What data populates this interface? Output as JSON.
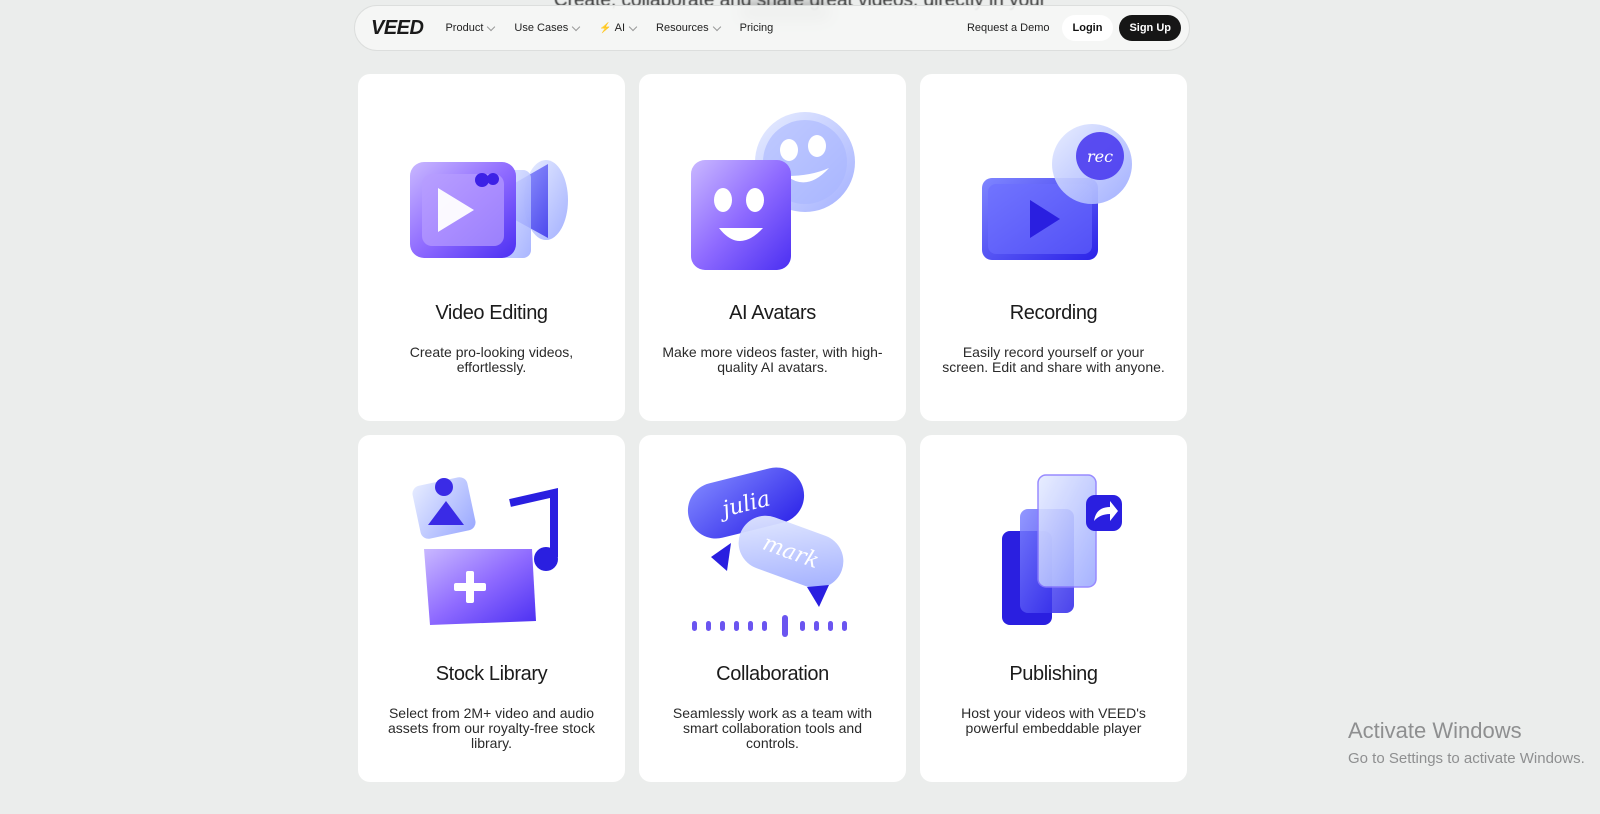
{
  "background_headline": "Create, collaborate and share great videos, directly in your",
  "nav": {
    "logo": "VEED",
    "items": [
      {
        "label": "Product"
      },
      {
        "label": "Use Cases"
      },
      {
        "label": "AI"
      },
      {
        "label": "Resources"
      },
      {
        "label": "Pricing"
      }
    ],
    "request_demo": "Request a Demo",
    "login": "Login",
    "signup": "Sign Up"
  },
  "cards": [
    {
      "title": "Video Editing",
      "description": "Create pro-looking videos, effortlessly.",
      "icon": "video-camera-icon"
    },
    {
      "title": "AI Avatars",
      "description": "Make more videos faster, with high-quality AI avatars.",
      "icon": "avatar-faces-icon"
    },
    {
      "title": "Recording",
      "description": "Easily record yourself or your screen. Edit and share with anyone.",
      "icon": "record-screen-icon",
      "badge_text": "rec"
    },
    {
      "title": "Stock Library",
      "description": "Select from 2M+ video and audio assets from our royalty-free stock library.",
      "icon": "stock-folder-icon"
    },
    {
      "title": "Collaboration",
      "description": "Seamlessly work as a team with smart collaboration tools and controls.",
      "icon": "chat-bubbles-icon",
      "bubble_names": [
        "julia",
        "mark"
      ]
    },
    {
      "title": "Publishing",
      "description": "Host your videos with VEED's powerful embeddable player",
      "icon": "share-layers-icon"
    }
  ],
  "watermark": {
    "line1": "Activate Windows",
    "line2": "Go to Settings to activate Windows."
  },
  "colors": {
    "accent": "#5b3cf5",
    "page_bg": "#ebedec",
    "card_bg": "#ffffff",
    "signup_bg": "#161616"
  }
}
